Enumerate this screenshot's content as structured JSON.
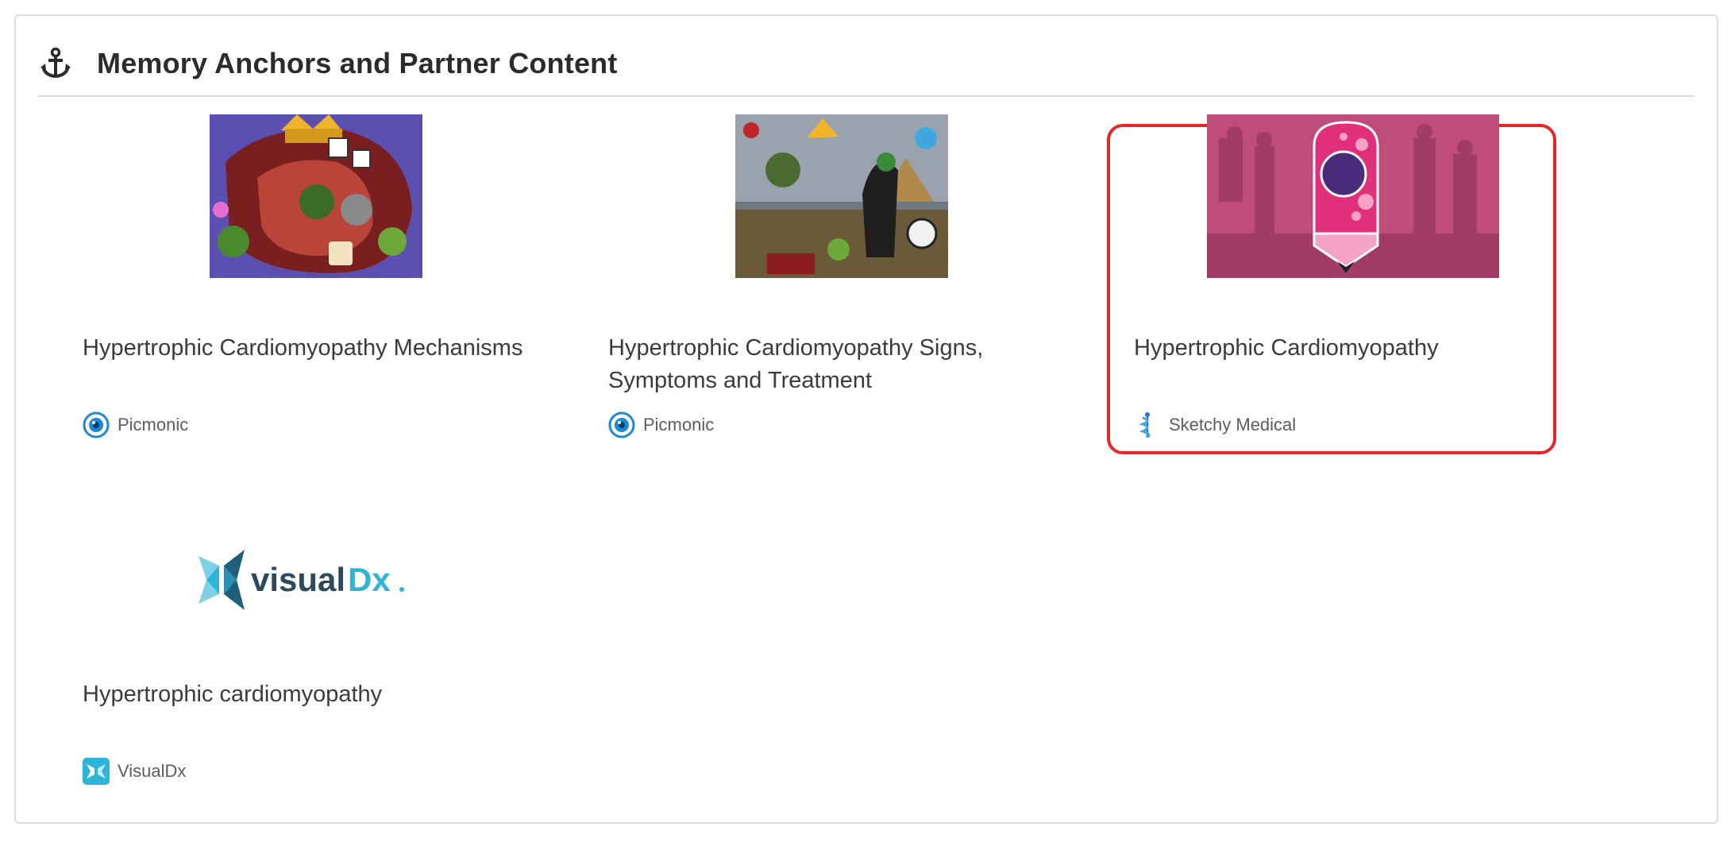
{
  "header": {
    "title": "Memory Anchors and Partner Content",
    "icon": "anchor-icon"
  },
  "colors": {
    "highlight_border": "#e8262a",
    "picmonic_blue": "#1e88d6",
    "sketchy_pink": "#e0307a",
    "visualdx_teal": "#2eb4d6"
  },
  "cards": [
    {
      "title": "Hypertrophic Cardiomyopathy Mechanisms",
      "source": "Picmonic",
      "source_icon": "picmonic-eye-icon",
      "thumbnail": "picmonic-illustration"
    },
    {
      "title": "Hypertrophic Cardiomyopathy Signs, Symptoms and Treatment",
      "source": "Picmonic",
      "source_icon": "picmonic-eye-icon",
      "thumbnail": "picmonic-illustration"
    },
    {
      "title": "Hypertrophic Cardiomyopathy",
      "source": "Sketchy Medical",
      "source_icon": "sketchy-caduceus-icon",
      "thumbnail": "sketchy-pencil-logo",
      "highlighted": true
    },
    {
      "title": "Hypertrophic cardiomyopathy",
      "source": "VisualDx",
      "source_icon": "visualdx-logo-icon",
      "thumbnail": "visualdx-wordmark",
      "logo_text_a": "visual",
      "logo_text_b": "Dx"
    }
  ]
}
